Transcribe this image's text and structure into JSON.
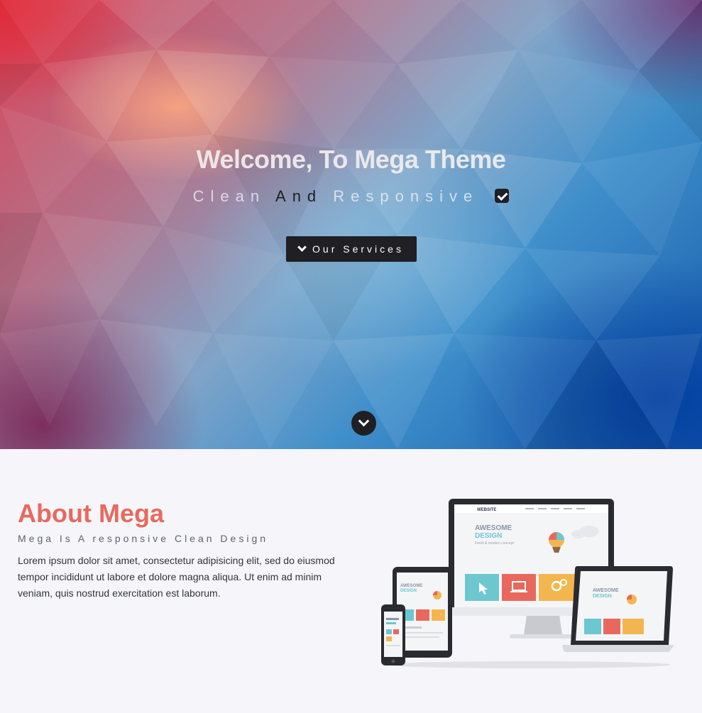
{
  "hero": {
    "title": "Welcome, To Mega Theme",
    "subtitle_part1": "Clean",
    "subtitle_part2": "And",
    "subtitle_part3": "Responsive",
    "subtitle_icon": "check-square-icon",
    "services_button_label": "Our Services",
    "services_button_icon": "chevron-down-icon",
    "scroll_icon": "chevron-down-circle-icon"
  },
  "about": {
    "title": "About Mega",
    "subtitle": "Mega Is A responsive Clean Design",
    "body": "Lorem ipsum dolor sit amet, consectetur adipisicing elit, sed do eiusmod tempor incididunt ut labore et dolore magna aliqua. Ut enim ad minim veniam, quis nostrud exercitation est laborum.",
    "devices_image": {
      "monitor_brand": "WEBSITE",
      "headline_1": "AWESOME",
      "headline_2": "DESIGN",
      "tagline": "Fresh & modern concept"
    }
  },
  "colors": {
    "accent": "#e8695e",
    "dark": "#1f1f24",
    "tile_teal": "#6cc7d0",
    "tile_red": "#e8685e",
    "tile_yellow": "#f3b64f"
  }
}
